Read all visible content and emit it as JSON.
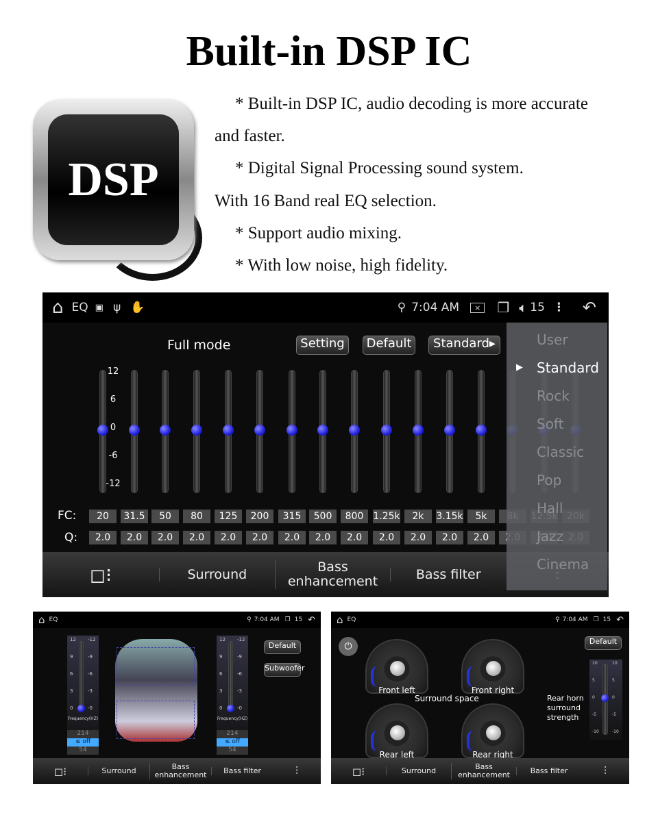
{
  "title": "Built-in DSP IC",
  "logo_text": "DSP",
  "description": [
    "* Built-in DSP IC, audio decoding is more accurate",
    "and faster.",
    "* Digital Signal Processing sound system.",
    "With 16 Band real EQ selection.",
    "* Support audio mixing.",
    "* With low noise, high fidelity."
  ],
  "status": {
    "app": "EQ",
    "time": "7:04 AM",
    "volume": "15"
  },
  "eq": {
    "mode": "Full mode",
    "setting": "Setting",
    "default": "Default",
    "preset": "Standard",
    "y_ticks": [
      "12",
      "6",
      "0",
      "-6",
      "-12"
    ],
    "fc_label": "FC:",
    "q_label": "Q:",
    "bands": [
      {
        "fc": "20",
        "q": "2.0",
        "gain": 0
      },
      {
        "fc": "31.5",
        "q": "2.0",
        "gain": 0
      },
      {
        "fc": "50",
        "q": "2.0",
        "gain": 0
      },
      {
        "fc": "80",
        "q": "2.0",
        "gain": 0
      },
      {
        "fc": "125",
        "q": "2.0",
        "gain": 0
      },
      {
        "fc": "200",
        "q": "2.0",
        "gain": 0
      },
      {
        "fc": "315",
        "q": "2.0",
        "gain": 0
      },
      {
        "fc": "500",
        "q": "2.0",
        "gain": 0
      },
      {
        "fc": "800",
        "q": "2.0",
        "gain": 0
      },
      {
        "fc": "1.25k",
        "q": "2.0",
        "gain": 0
      },
      {
        "fc": "2k",
        "q": "2.0",
        "gain": 0
      },
      {
        "fc": "3.15k",
        "q": "2.0",
        "gain": 0
      },
      {
        "fc": "5k",
        "q": "2.0",
        "gain": 0
      },
      {
        "fc": "8k",
        "q": "2.0",
        "gain": 0
      },
      {
        "fc": "12.5k",
        "q": "2.0",
        "gain": 0
      },
      {
        "fc": "20k",
        "q": "2.0",
        "gain": 0
      }
    ],
    "presets": [
      "User",
      "Standard",
      "Rock",
      "Soft",
      "Classic",
      "Pop",
      "Hall",
      "Jazz",
      "Cinema"
    ],
    "selected_preset": "Standard"
  },
  "tabs": {
    "surround": "Surround",
    "bass_enh_1": "Bass",
    "bass_enh_2": "enhancement",
    "bass_filter": "Bass filter"
  },
  "bass": {
    "ticks": [
      "12",
      "9",
      "6",
      "3",
      "0"
    ],
    "ticks_r": [
      "-12",
      "-9",
      "-6",
      "-3",
      "-0"
    ],
    "freq_label": "Frequency(HZ)",
    "list": [
      "214",
      "≤ off",
      "54"
    ],
    "default": "Default",
    "subwoofer": "Subwoofer"
  },
  "surround": {
    "default": "Default",
    "gauges": [
      "Front left",
      "Front right",
      "Rear left",
      "Rear right"
    ],
    "space": "Surround space",
    "rear_label": [
      "Rear horn",
      "surround",
      "strength"
    ],
    "ticks": [
      "10",
      "5",
      "0",
      "-5",
      "-10"
    ],
    "accent": "#2233dd"
  }
}
